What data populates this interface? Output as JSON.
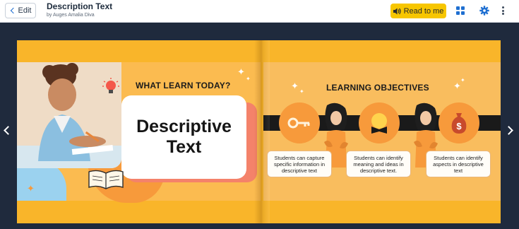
{
  "header": {
    "edit_label": "Edit",
    "title": "Description Text",
    "byline": "by Auges Amalia Diva",
    "read_label": "Read to me"
  },
  "colors": {
    "accent_blue": "#1f6fd1",
    "read_button": "#f7c600",
    "stage_bg": "#1f2a3d",
    "book_orange": "#f9b52a"
  },
  "icons": {
    "edit": "chevron-left-icon",
    "read": "speaker-icon",
    "grid": "grid-icon",
    "settings": "gear-icon",
    "more": "more-vertical-icon",
    "prev": "chevron-left-icon",
    "next": "chevron-right-icon"
  },
  "book": {
    "left_page": {
      "heading": "WHAT LEARN TODAY?",
      "card_line1": "Descriptive",
      "card_line2": "Text"
    },
    "right_page": {
      "heading": "LEARNING OBJECTIVES",
      "objectives": [
        "Students can capture specific information in descriptive text",
        "Students can identify meaning and ideas in descriptive text.",
        "Students can identify aspects in descriptive text"
      ]
    }
  }
}
